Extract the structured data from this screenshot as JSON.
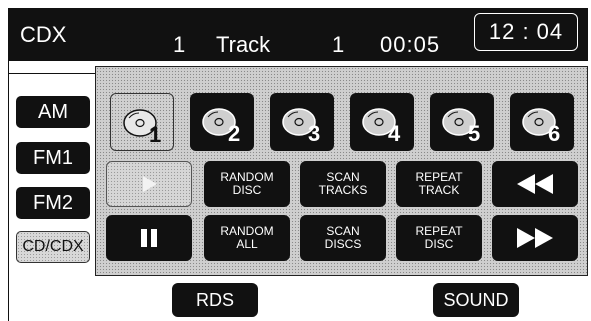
{
  "header": {
    "source_title": "CDX",
    "disc_number": "1",
    "track_label": "Track",
    "track_number": "1",
    "elapsed_time": "00:05",
    "clock": "12 : 04"
  },
  "sources": [
    {
      "label": "AM"
    },
    {
      "label": "FM1"
    },
    {
      "label": "FM2"
    },
    {
      "label": "CD/CDX"
    }
  ],
  "discs": [
    {
      "number": "1"
    },
    {
      "number": "2"
    },
    {
      "number": "3"
    },
    {
      "number": "4"
    },
    {
      "number": "5"
    },
    {
      "number": "6"
    }
  ],
  "controls": {
    "random_disc": "RANDOM\nDISC",
    "scan_tracks": "SCAN\nTRACKS",
    "repeat_track": "REPEAT\nTRACK",
    "random_all": "RANDOM\nALL",
    "scan_discs": "SCAN\nDISCS",
    "repeat_disc": "REPEAT\nDISC"
  },
  "bottom": {
    "rds": "RDS",
    "sound": "SOUND"
  },
  "icons": {
    "play": "play-icon",
    "pause": "pause-icon",
    "rewind": "rewind-icon",
    "fast_forward": "fast-forward-icon",
    "disc": "disc-icon"
  }
}
